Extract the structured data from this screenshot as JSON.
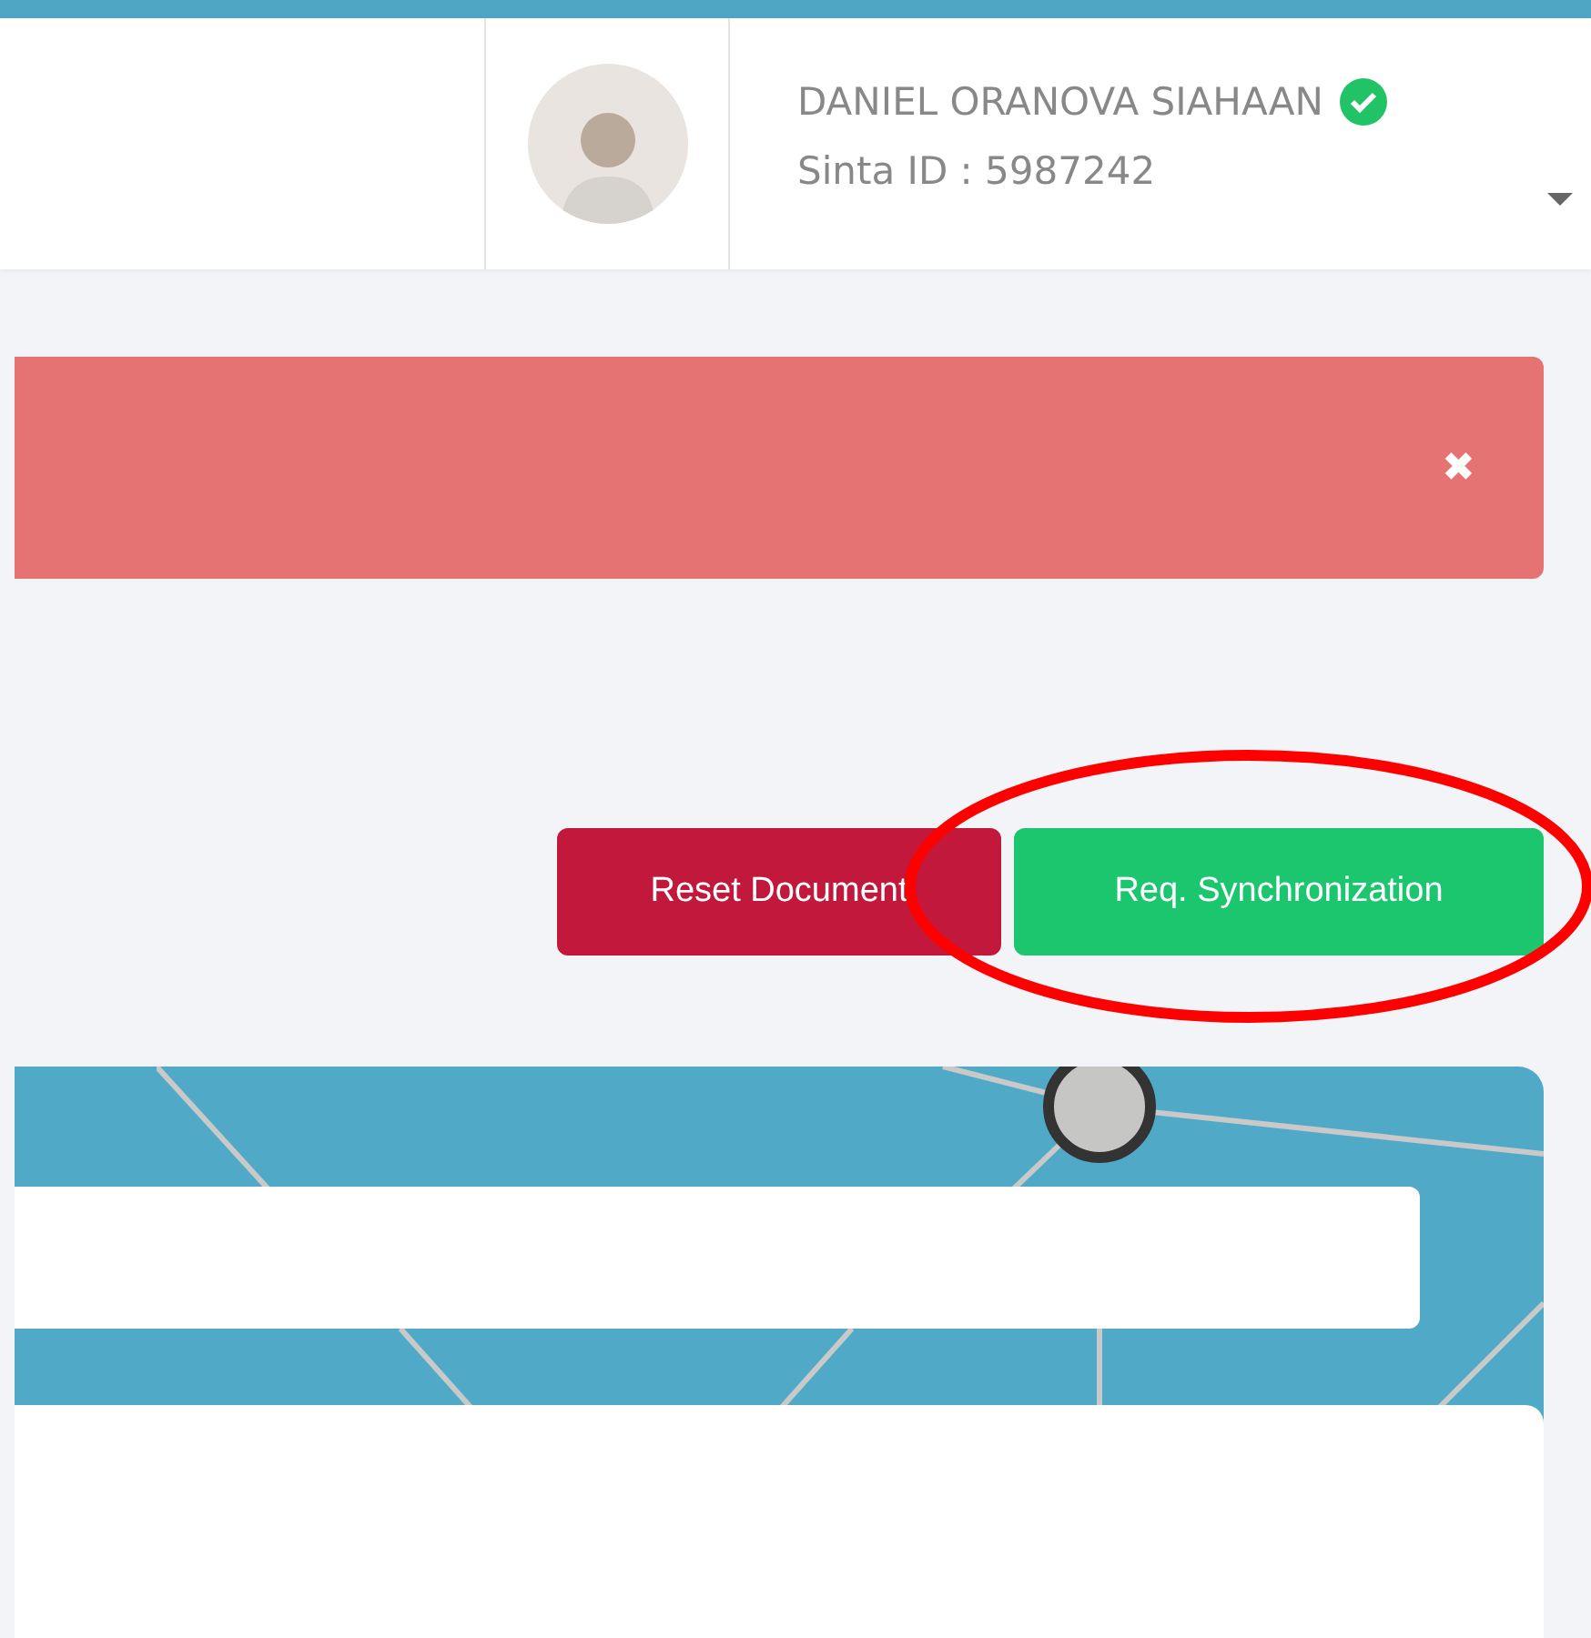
{
  "user": {
    "name": "DANIEL ORANOVA SIAHAAN",
    "verified": true,
    "sinta_id": "Sinta ID : 5987242"
  },
  "alert": {
    "close": "✖"
  },
  "buttons": [
    {
      "label": "Reset Document",
      "kind": "danger"
    },
    {
      "label": "Req. Synchronization",
      "kind": "success"
    }
  ]
}
